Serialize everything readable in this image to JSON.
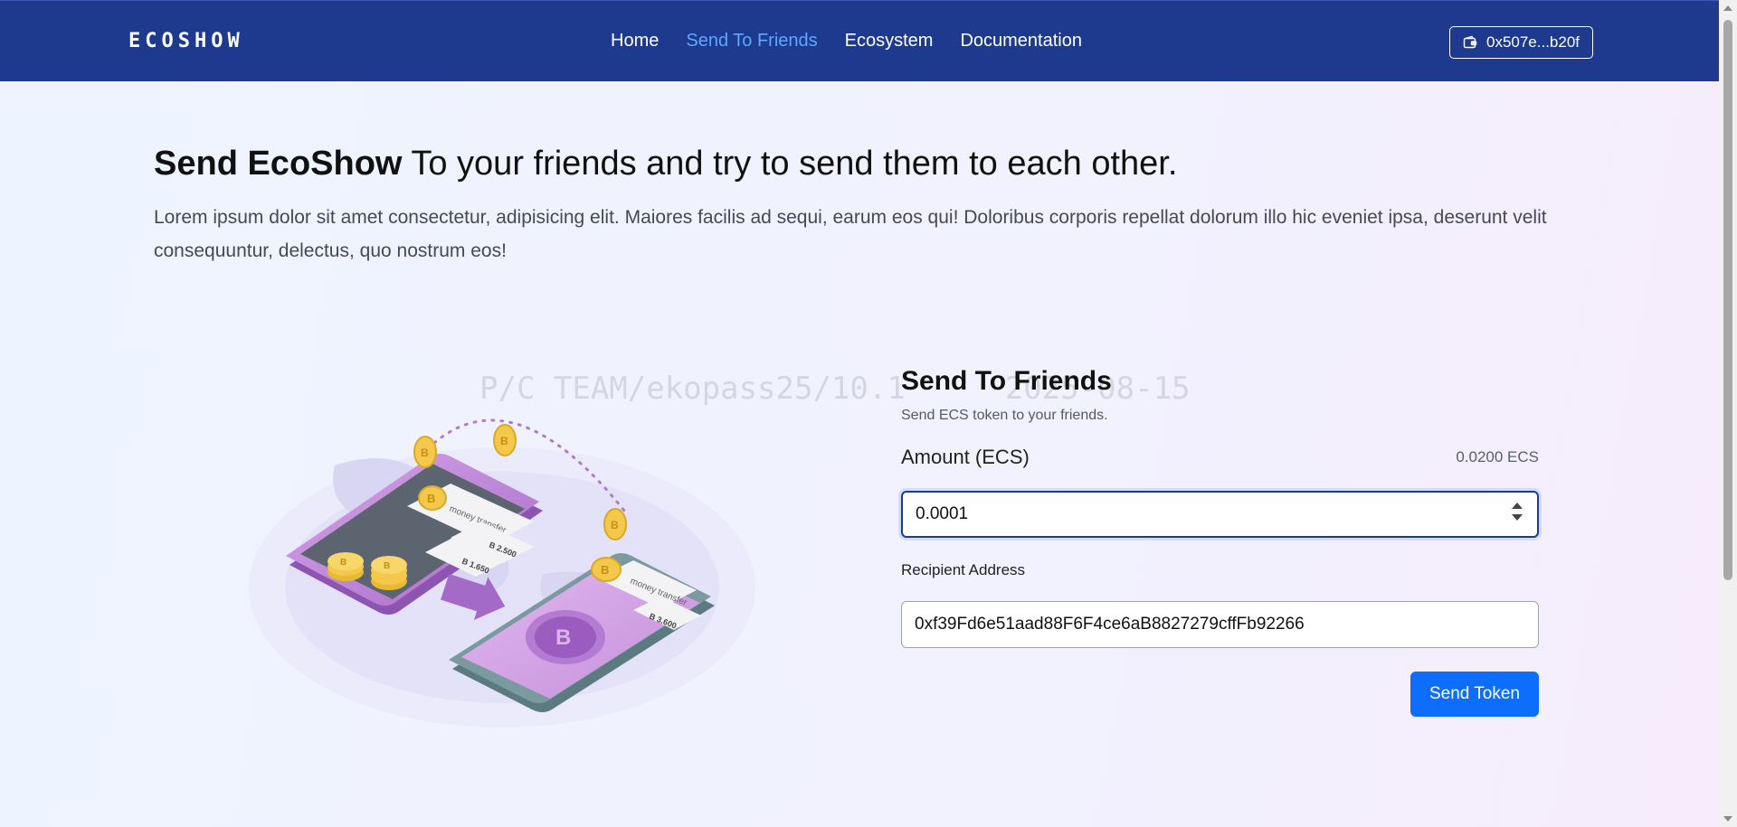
{
  "brand": "ECOSHOW",
  "nav": {
    "links": [
      {
        "label": "Home",
        "active": false
      },
      {
        "label": "Send To Friends",
        "active": true
      },
      {
        "label": "Ecosystem",
        "active": false
      },
      {
        "label": "Documentation",
        "active": false
      }
    ],
    "wallet_label": "0x507e...b20f"
  },
  "hero": {
    "title_bold": "Send EcoShow",
    "title_rest": " To your friends and try to send them to each other.",
    "description": "Lorem ipsum dolor sit amet consectetur, adipisicing elit. Maiores facilis ad sequi, earum eos qui! Doloribus corporis repellat dolorum illo hic eveniet ipsa, deserunt velit consequuntur, delectus, quo nostrum eos!"
  },
  "watermark": "P/C TEAM/ekopass25/10.1",
  "watermark_date": "2025-08-15",
  "illustration": {
    "caption_top": "money transfer",
    "amount_1": "B 2.500",
    "amount_2": "B 1.650",
    "caption_bottom": "money transfer",
    "amount_3": "B 3.600"
  },
  "form": {
    "title": "Send To Friends",
    "subtitle": "Send ECS token to your friends.",
    "amount_label": "Amount (ECS)",
    "balance": "0.0200 ECS",
    "amount_value": "0.0001",
    "recipient_label": "Recipient Address",
    "recipient_value": "0xf39Fd6e51aad88F6F4ce6aB8827279cffFb92266",
    "submit_label": "Send Token"
  },
  "colors": {
    "navbar": "#1d3a8f",
    "nav_active": "#5ea8ff",
    "primary_button": "#0d6efd"
  }
}
